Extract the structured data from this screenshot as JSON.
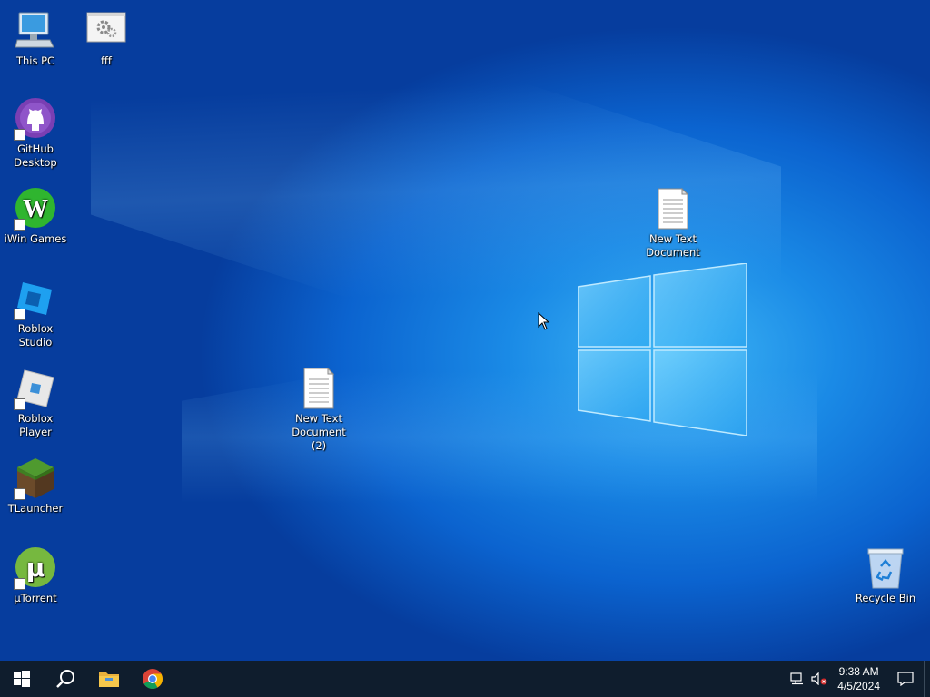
{
  "desktop": {
    "icons": [
      {
        "label": "This PC",
        "icon": "this-pc-icon"
      },
      {
        "label": "fff",
        "icon": "settings-file-icon"
      },
      {
        "label": "GitHub Desktop",
        "icon": "github-desktop-icon"
      },
      {
        "label": "iWin Games",
        "icon": "iwin-games-icon"
      },
      {
        "label": "Roblox Studio",
        "icon": "roblox-studio-icon"
      },
      {
        "label": "Roblox Player",
        "icon": "roblox-player-icon"
      },
      {
        "label": "TLauncher",
        "icon": "tlauncher-icon"
      },
      {
        "label": "µTorrent",
        "icon": "utorrent-icon"
      },
      {
        "label": "New Text Document",
        "icon": "text-document-icon"
      },
      {
        "label": "New Text Document (2)",
        "icon": "text-document-icon"
      },
      {
        "label": "Recycle Bin",
        "icon": "recycle-bin-icon"
      }
    ]
  },
  "taskbar": {
    "pinned": [
      {
        "name": "Start",
        "icon": "windows-start-icon"
      },
      {
        "name": "Search",
        "icon": "search-icon"
      },
      {
        "name": "File Explorer",
        "icon": "file-explorer-icon"
      },
      {
        "name": "Google Chrome",
        "icon": "chrome-icon"
      }
    ],
    "tray": {
      "network_icon": "network-icon",
      "volume_icon": "volume-muted-icon",
      "time": "9:38 AM",
      "date": "4/5/2024",
      "notification_icon": "action-center-icon"
    }
  },
  "colors": {
    "taskbar_bg": "#0f1d2d",
    "desktop_accent": "#0a6ad8"
  }
}
